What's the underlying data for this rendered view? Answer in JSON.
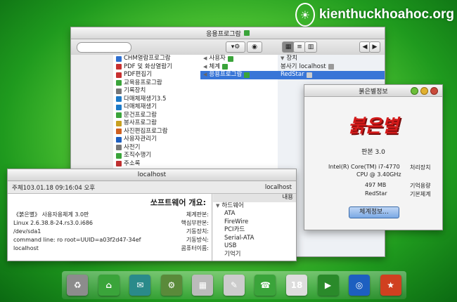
{
  "watermark": {
    "text": "kienthuckhoahoc.org"
  },
  "file_manager": {
    "title": "응용프로그람",
    "nav_back": "◀",
    "nav_forward": "▶",
    "left_pane": [
      {
        "label": "CHM열람프로그람",
        "color": "#2e6fd0"
      },
      {
        "label": "PDF 및 화상열람기",
        "color": "#c83030"
      },
      {
        "label": "PDF편집기",
        "color": "#c83030"
      },
      {
        "label": "교육용프로그람",
        "color": "#3aa43a"
      },
      {
        "label": "기록장치",
        "color": "#777777"
      },
      {
        "label": "다매체재생기3.5",
        "color": "#1d7ac8"
      },
      {
        "label": "다매체재생기",
        "color": "#1d7ac8"
      },
      {
        "label": "문건프로그람",
        "color": "#3aa43a"
      },
      {
        "label": "봉사프로그람",
        "color": "#c8a020"
      },
      {
        "label": "사진편집프로그람",
        "color": "#d06020"
      },
      {
        "label": "사용자관리기",
        "color": "#1d5fc0"
      },
      {
        "label": "사전기",
        "color": "#777777"
      },
      {
        "label": "조직수행기",
        "color": "#3aa43a"
      },
      {
        "label": "주소록",
        "color": "#c03030"
      }
    ],
    "right_pane": [
      {
        "label": "사용자",
        "color": "#3aa43a",
        "selected": false
      },
      {
        "label": "체계",
        "color": "#3aa43a",
        "selected": false
      },
      {
        "label": "응용프로그람",
        "color": "#3aa43a",
        "selected": true
      }
    ],
    "sidebar": [
      {
        "label": "장치",
        "selected": false
      },
      {
        "label": "localhost",
        "selected": false
      },
      {
        "label": "RedStar",
        "selected": true
      }
    ],
    "sidebar_extra": "봉사기"
  },
  "about_dialog": {
    "title": "붉은별정보",
    "logo_text": "붉은별",
    "version": "판본 3.0",
    "specs": [
      {
        "key": "처리장치",
        "value": "Intel(R) Core(TM) i7-4770"
      },
      {
        "key": "",
        "value": "CPU @ 3.40GHz"
      },
      {
        "key": "기억용량",
        "value": "497 MB"
      },
      {
        "key": "기본체계",
        "value": "RedStar"
      }
    ],
    "ok_label": "체계정보..."
  },
  "sysinfo": {
    "title": "localhost",
    "host_line": "localhost",
    "datetime": "주체103.01.18 09:16:04 오후",
    "heading": "쏘프트웨어 개요:",
    "fields": [
      {
        "key": "체계판본:",
        "value": "《붉은별》 사용자용체계 3.0판"
      },
      {
        "key": "핵심부판본:",
        "value": "Linux 2.6.38.8-24.rs3.0.i686"
      },
      {
        "key": "기동장치:",
        "value": "/dev/sda1"
      },
      {
        "key": "기동방식:",
        "value": "command line: ro root=UUID=a03f2d47-34ef"
      },
      {
        "key": "콤퓨터이름:",
        "value": "localhost"
      }
    ],
    "tree_header": "내용",
    "tree": [
      {
        "label": "하드웨어",
        "expanded": true
      },
      {
        "label": "ATA",
        "expanded": false
      },
      {
        "label": "FireWire",
        "expanded": false
      },
      {
        "label": "PCI카드",
        "expanded": false
      },
      {
        "label": "Serial-ATA",
        "expanded": false
      },
      {
        "label": "USB",
        "expanded": false
      },
      {
        "label": "기억기",
        "expanded": false
      }
    ]
  },
  "dock": {
    "items": [
      {
        "name": "trash-icon",
        "color": "#8c8c8c",
        "glyph": "♻"
      },
      {
        "name": "home-icon",
        "color": "#3aa43a",
        "glyph": "⌂"
      },
      {
        "name": "chat-icon",
        "color": "#2a8a8a",
        "glyph": "✉"
      },
      {
        "name": "system-tools-icon",
        "color": "#5a8a3a",
        "glyph": "⚙"
      },
      {
        "name": "calculator-icon",
        "color": "#bbbbbb",
        "glyph": "▦"
      },
      {
        "name": "text-editor-icon",
        "color": "#cccccc",
        "glyph": "✎"
      },
      {
        "name": "contacts-icon",
        "color": "#3aa43a",
        "glyph": "☎"
      },
      {
        "name": "calendar-icon",
        "color": "#dddddd",
        "glyph": "18"
      },
      {
        "name": "video-icon",
        "color": "#2a8a2a",
        "glyph": "▶"
      },
      {
        "name": "browser-icon",
        "color": "#1d5fc0",
        "glyph": "◎"
      },
      {
        "name": "office-icon",
        "color": "#d04020",
        "glyph": "★"
      }
    ]
  }
}
